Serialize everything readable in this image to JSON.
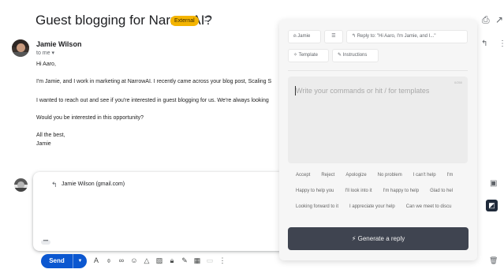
{
  "email": {
    "subject": "Guest blogging for NarrowAI?",
    "badge": "External",
    "sender": "Jamie Wilson",
    "to": "to me ▾",
    "body": [
      "Hi Aaro,",
      "I'm Jamie, and I work in marketing at NarrowAI. I recently came across your blog post, Scaling S",
      "I wanted to reach out and see if you're interested in guest blogging for us. We're always looking",
      "Would you be interested in this opportunity?",
      "All the best,",
      "Jamie"
    ]
  },
  "reply": {
    "to": "Jamie Wilson (gmail.com)",
    "send_label": "Send"
  },
  "panel": {
    "sender_chip": "Jamie",
    "reply_to_chip": "Reply to: \"Hi Aaro, I'm Jamie, and I...\"",
    "template_chip": "Template",
    "instructions_chip": "Instructions",
    "counter": "0/250",
    "placeholder": "Write your commands or hit / for templates",
    "templates": [
      [
        "Accept",
        "Reject",
        "Apologize",
        "No problem",
        "I can't help",
        "I'm"
      ],
      [
        "Happy to help you",
        "I'll look into it",
        "I'm happy to help",
        "Glad to hel"
      ],
      [
        "Looking forward to it",
        "I appreciate your help",
        "Can we meet to discu"
      ]
    ],
    "generate_label": "Generate a reply"
  },
  "icons": {
    "label": "label-outline-icon",
    "print": "print-icon",
    "open_new": "open-in-new-icon",
    "reply": "reply-icon",
    "more": "more-vert-icon",
    "trash": "trash-icon"
  },
  "colors": {
    "send": "#0b57d0",
    "badge": "#f4b400",
    "generate": "#3f4450",
    "panel": "#f6f6f6"
  }
}
